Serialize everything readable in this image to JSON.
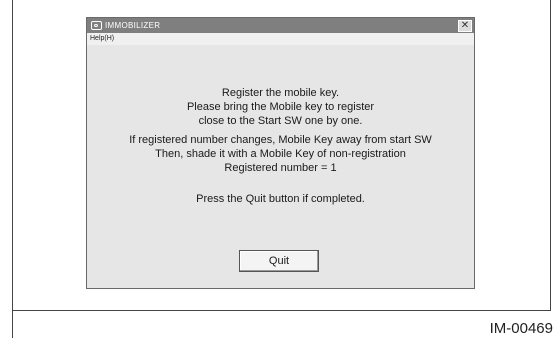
{
  "window": {
    "title": "IMMOBILIZER",
    "close_glyph": "✕"
  },
  "menubar": {
    "help_label": "Help(H)"
  },
  "message": {
    "lines_a": [
      "Register the mobile key.",
      "Please bring the Mobile key to register",
      "close to the Start SW one by one."
    ],
    "lines_b": [
      "If registered number changes, Mobile Key away from start SW",
      "Then, shade it with a Mobile Key of non-registration",
      "Registered number = 1"
    ],
    "completion_text": "Press the Quit button if completed."
  },
  "quit_button": {
    "label": "Quit"
  },
  "figure_code": "IM-00469"
}
